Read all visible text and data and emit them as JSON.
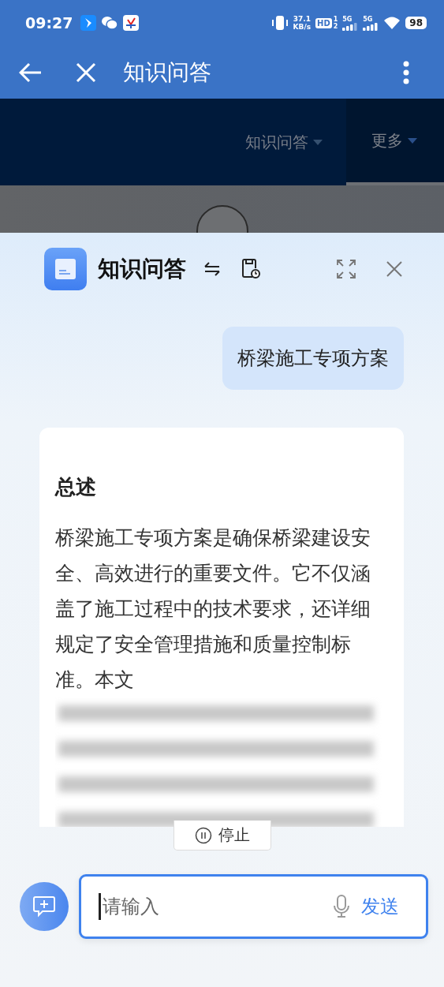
{
  "status_bar": {
    "time": "09:27",
    "speed": "37.1",
    "speed_unit": "KB/s",
    "hd": "HD",
    "sim_1": "1",
    "sim_2": "2",
    "networks": [
      "5G",
      "5G"
    ],
    "battery": "98"
  },
  "app_bar": {
    "title": "知识问答"
  },
  "site_nav": [
    {
      "label": "知识问答",
      "selected": false
    },
    {
      "label": "更多",
      "selected": true
    }
  ],
  "panel": {
    "title": "知识问答"
  },
  "messages": [
    {
      "kind": "user",
      "text": "桥梁施工专项方案"
    },
    {
      "kind": "answer",
      "heading": "总述",
      "text": "桥梁施工专项方案是确保桥梁建设安全、高效进行的重要文件。它不仅涵盖了施工过程中的技术要求，还详细规定了安全管理措施和质量控制标准。本文"
    }
  ],
  "stop_button": {
    "label": "停止"
  },
  "composer": {
    "placeholder": "请输入",
    "send": "发送"
  }
}
